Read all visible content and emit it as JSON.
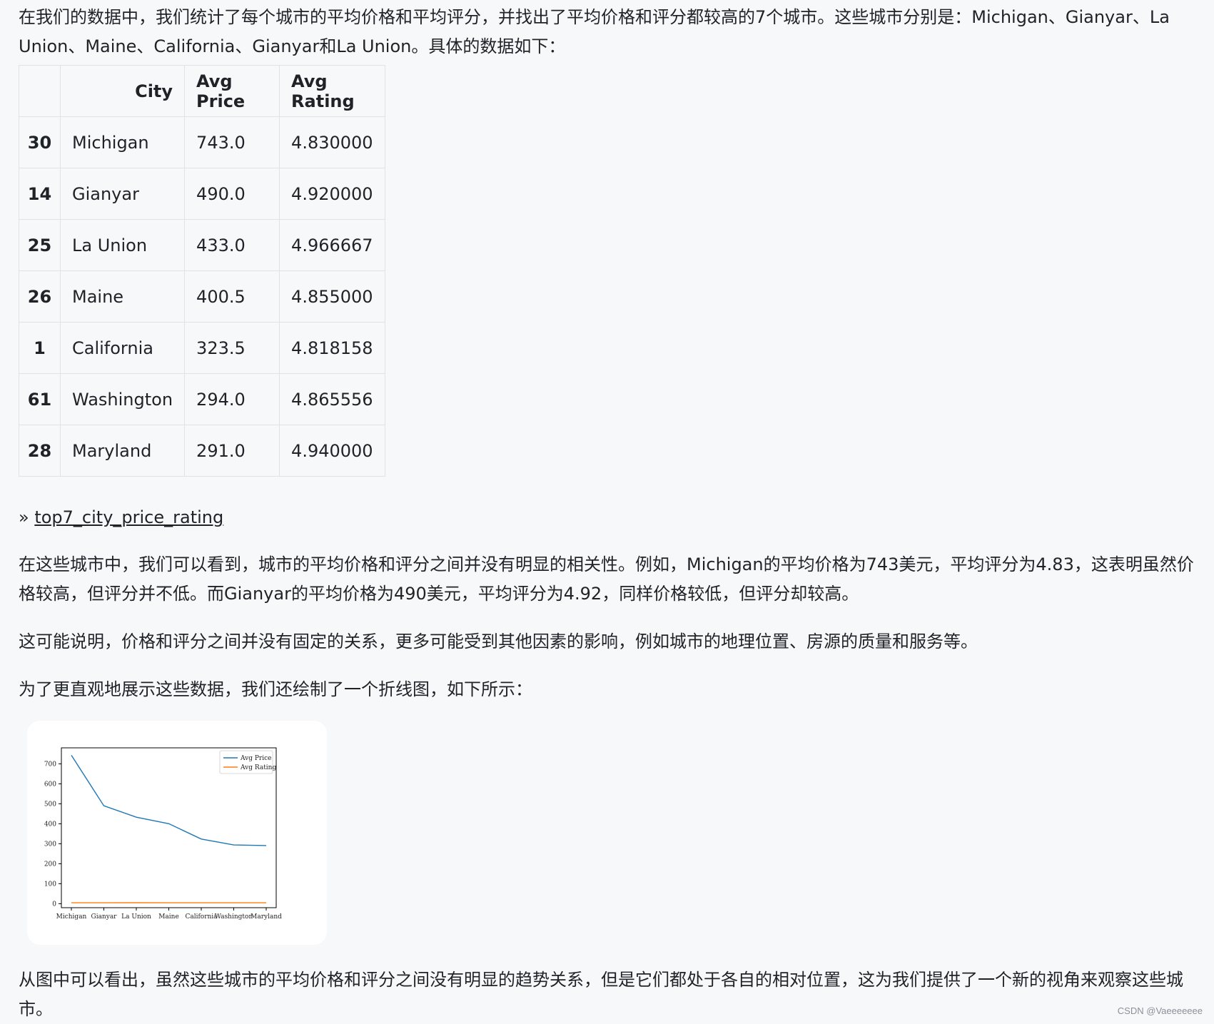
{
  "paragraphs": {
    "intro": "在我们的数据中，我们统计了每个城市的平均价格和平均评分，并找出了平均价格和评分都较高的7个城市。这些城市分别是：Michigan、Gianyar、La Union、Maine、California、Gianyar和La Union。具体的数据如下：",
    "correlation": "在这些城市中，我们可以看到，城市的平均价格和评分之间并没有明显的相关性。例如，Michigan的平均价格为743美元，平均评分为4.83，这表明虽然价格较高，但评分并不低。而Gianyar的平均价格为490美元，平均评分为4.92，同样价格较低，但评分却较高。",
    "reason": "这可能说明，价格和评分之间并没有固定的关系，更多可能受到其他因素的影响，例如城市的地理位置、房源的质量和服务等。",
    "chart_intro": "为了更直观地展示这些数据，我们还绘制了一个折线图，如下所示：",
    "conclusion": "从图中可以看出，虽然这些城市的平均价格和评分之间没有明显的趋势关系，但是它们都处于各自的相对位置，这为我们提供了一个新的视角来观察这些城市。"
  },
  "table": {
    "headers": [
      "",
      "City",
      "Avg Price",
      "Avg Rating"
    ],
    "rows": [
      {
        "index": "30",
        "city": "Michigan",
        "price": "743.0",
        "rating": "4.830000"
      },
      {
        "index": "14",
        "city": "Gianyar",
        "price": "490.0",
        "rating": "4.920000"
      },
      {
        "index": "25",
        "city": "La Union",
        "price": "433.0",
        "rating": "4.966667"
      },
      {
        "index": "26",
        "city": "Maine",
        "price": "400.5",
        "rating": "4.855000"
      },
      {
        "index": "1",
        "city": "California",
        "price": "323.5",
        "rating": "4.818158"
      },
      {
        "index": "61",
        "city": "Washington",
        "price": "294.0",
        "rating": "4.865556"
      },
      {
        "index": "28",
        "city": "Maryland",
        "price": "291.0",
        "rating": "4.940000"
      }
    ]
  },
  "link": {
    "prefix": "»",
    "label": "top7_city_price_rating"
  },
  "chart_data": {
    "type": "line",
    "title": "",
    "xlabel": "",
    "ylabel": "",
    "categories": [
      "Michigan",
      "Gianyar",
      "La Union",
      "Maine",
      "California",
      "Washington",
      "Maryland"
    ],
    "series": [
      {
        "name": "Avg Price",
        "color": "#1f77b4",
        "values": [
          743.0,
          490.0,
          433.0,
          400.5,
          323.5,
          294.0,
          291.0
        ]
      },
      {
        "name": "Avg Rating",
        "color": "#ff7f0e",
        "values": [
          4.83,
          4.92,
          4.966667,
          4.855,
          4.818158,
          4.865556,
          4.94
        ]
      }
    ],
    "yticks": [
      0,
      100,
      200,
      300,
      400,
      500,
      600,
      700
    ],
    "ylim": [
      -20,
      780
    ],
    "legend": "top-right",
    "grid": false
  },
  "watermark": "CSDN @Vaeeeeeee"
}
